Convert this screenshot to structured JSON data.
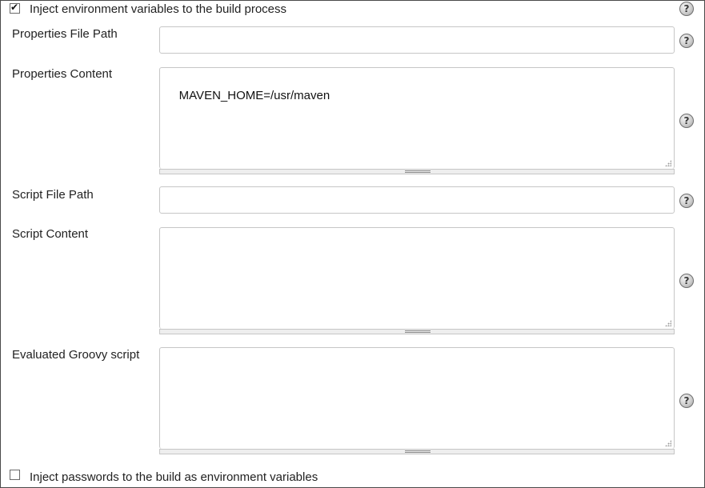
{
  "inject_env": {
    "checked": true,
    "label": "Inject environment variables to the build process"
  },
  "fields": {
    "properties_file_path": {
      "label": "Properties File Path",
      "value": ""
    },
    "properties_content": {
      "label": "Properties Content",
      "value": "MAVEN_HOME=/usr/maven"
    },
    "script_file_path": {
      "label": "Script File Path",
      "value": ""
    },
    "script_content": {
      "label": "Script Content",
      "value": ""
    },
    "groovy_script": {
      "label": "Evaluated Groovy script",
      "value": ""
    }
  },
  "inject_passwords": {
    "checked": false,
    "label": "Inject passwords to the build as environment variables"
  },
  "icons": {
    "help": "help-icon",
    "help_glyph": "?"
  },
  "colors": {
    "border": "#c6c6c6",
    "frame": "#4a4a4a",
    "text": "#222222"
  }
}
